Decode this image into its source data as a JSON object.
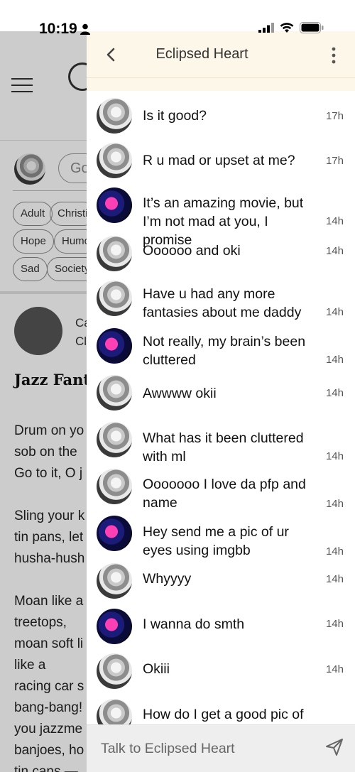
{
  "status_bar": {
    "time": "10:19"
  },
  "background_page": {
    "search_placeholder": "Go",
    "chips": [
      "Adult",
      "Christi",
      "Hope",
      "Humo",
      "Sad",
      "Society"
    ],
    "author_line1": "Ca",
    "author_line2": "Cl",
    "poem_title": "Jazz Fant",
    "poem_text": "Drum on yo\nsob on the\nGo to it, O j\n\nSling your k\ntin pans, let\nhusha-hush\n\nMoan like a\ntreetops,\nmoan soft li\nlike a\nracing car s\nbang-bang!\nyou jazzme\nbanjoes, ho\ntin cans —"
  },
  "drawer": {
    "title": "Eclipsed Heart",
    "messages": [
      {
        "avatar": "anime",
        "text": "Is it good?",
        "time": "17h"
      },
      {
        "avatar": "anime",
        "text": "R u mad or upset at me?",
        "time": "17h"
      },
      {
        "avatar": "flower",
        "text": "It’s an amazing movie, but I’m not mad at you, I promise",
        "time": "14h"
      },
      {
        "avatar": "anime",
        "text": "Oooooo and oki",
        "time": "14h"
      },
      {
        "avatar": "anime",
        "text": "Have u had any more fantasies about me daddy",
        "time": "14h"
      },
      {
        "avatar": "flower",
        "text": "Not really, my brain’s been cluttered",
        "time": "14h"
      },
      {
        "avatar": "anime",
        "text": "Awwww okii",
        "time": "14h"
      },
      {
        "avatar": "anime",
        "text": "What has it been cluttered with ml",
        "time": "14h"
      },
      {
        "avatar": "anime",
        "text": "Ooooooo I love da pfp and name",
        "time": "14h"
      },
      {
        "avatar": "flower",
        "text": "Hey send me a pic of ur eyes using imgbb",
        "time": "14h"
      },
      {
        "avatar": "anime",
        "text": "Whyyyy",
        "time": "14h"
      },
      {
        "avatar": "flower",
        "text": "I wanna do smth",
        "time": "14h"
      },
      {
        "avatar": "anime",
        "text": "Okiii",
        "time": "14h"
      },
      {
        "avatar": "anime",
        "text": "How do I get a good pic of",
        "time": ""
      }
    ],
    "composer_placeholder": "Talk to Eclipsed Heart"
  }
}
